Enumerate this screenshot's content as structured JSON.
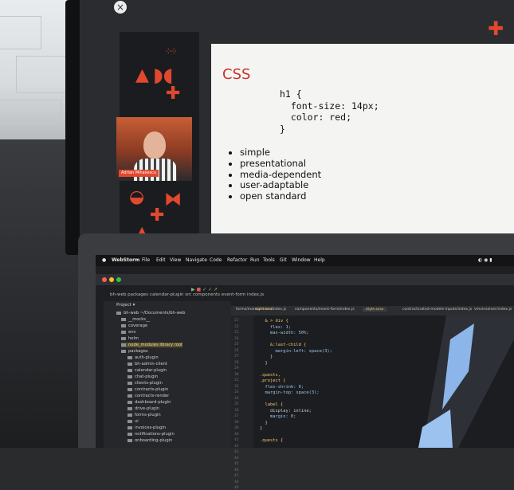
{
  "monitor": {
    "close_glyph": "×",
    "webcam_name": "Adrian Mihailescu",
    "slide": {
      "title": "CSS",
      "code": "h1 {\n  font-size: 14px;\n  color: red;\n}",
      "bullets": [
        "simple",
        "presentational",
        "media-dependent",
        "user-adaptable",
        "open standard"
      ]
    },
    "accent_color": "#e2482e"
  },
  "laptop": {
    "app_name": "WebStorm",
    "menu": [
      "File",
      "Edit",
      "View",
      "Navigate",
      "Code",
      "Refactor",
      "Run",
      "Tools",
      "Git",
      "Window",
      "Help"
    ],
    "breadcrumbs": "bh-web  packages  calendar-plugin  src  components  event-form  index.js",
    "project_label": "Project",
    "root_label": "bh-web ~/Documents/bh-web",
    "tree": [
      "__mocks__",
      "coverage",
      "env",
      "helm",
      "node_modules  library root",
      "packages",
      "auth-plugin",
      "bh-admin-client",
      "calendar-plugin",
      "chat-plugin",
      "clients-plugin",
      "contracts-plugin",
      "contracts-render",
      "dashboard-plugin",
      "drive-plugin",
      "forms-plugin",
      "ui",
      "invoices-plugin",
      "notifications-plugin",
      "onboarding-plugin"
    ],
    "tabs": [
      "forms/manual-time/index.js",
      "style.scss",
      "components/event-form/index.js",
      "style.scss",
      "contractsrated-models-inputs/index.js",
      "vmvinsolver/index.js"
    ],
    "line_numbers": [
      "21",
      "22",
      "23",
      "24",
      "25",
      "26",
      "27",
      "28",
      "29",
      "30",
      "31",
      "32",
      "33",
      "34",
      "35",
      "36",
      "37",
      "38",
      "39",
      "40",
      "41",
      "42",
      "43",
      "44",
      "45",
      "46",
      "47",
      "48",
      "49"
    ],
    "code_lines": [
      "  & > div {",
      "    flex: 1;",
      "    max-width: 50%;",
      "",
      "    &:last-child {",
      "      margin-left: space(3);",
      "    }",
      "  }",
      "",
      ".quests,",
      ".project {",
      "  flex-shrink: 0;",
      "  margin-top: space(3);",
      "",
      "  label {",
      "    display: inline;",
      "    margin: 0;",
      "  }",
      "}",
      "",
      ".quests {"
    ]
  }
}
